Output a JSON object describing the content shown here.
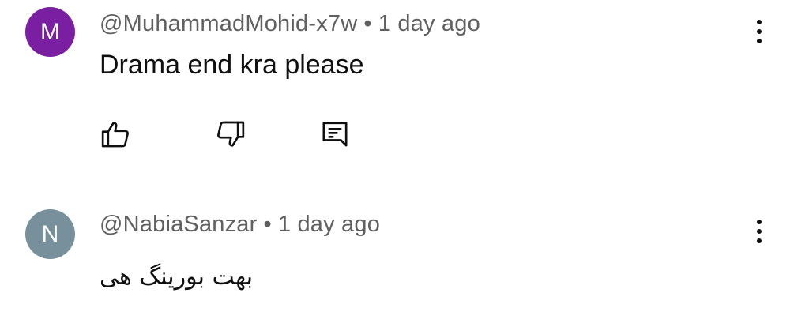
{
  "comments": [
    {
      "avatar_letter": "M",
      "avatar_color": "#7b1fa2",
      "author": "@MuhammadMohid-x7w",
      "separator": "•",
      "time": "1 day ago",
      "text": "Drama end kra please",
      "actions": [
        "thumbs-up-icon",
        "thumbs-down-icon",
        "reply-icon"
      ]
    },
    {
      "avatar_letter": "N",
      "avatar_color": "#78909c",
      "author": "@NabiaSanzar",
      "separator": "•",
      "time": "1 day ago",
      "text": "بهت بورینگ هی",
      "actions": []
    }
  ],
  "icons": {
    "more": "more-vert-icon"
  }
}
